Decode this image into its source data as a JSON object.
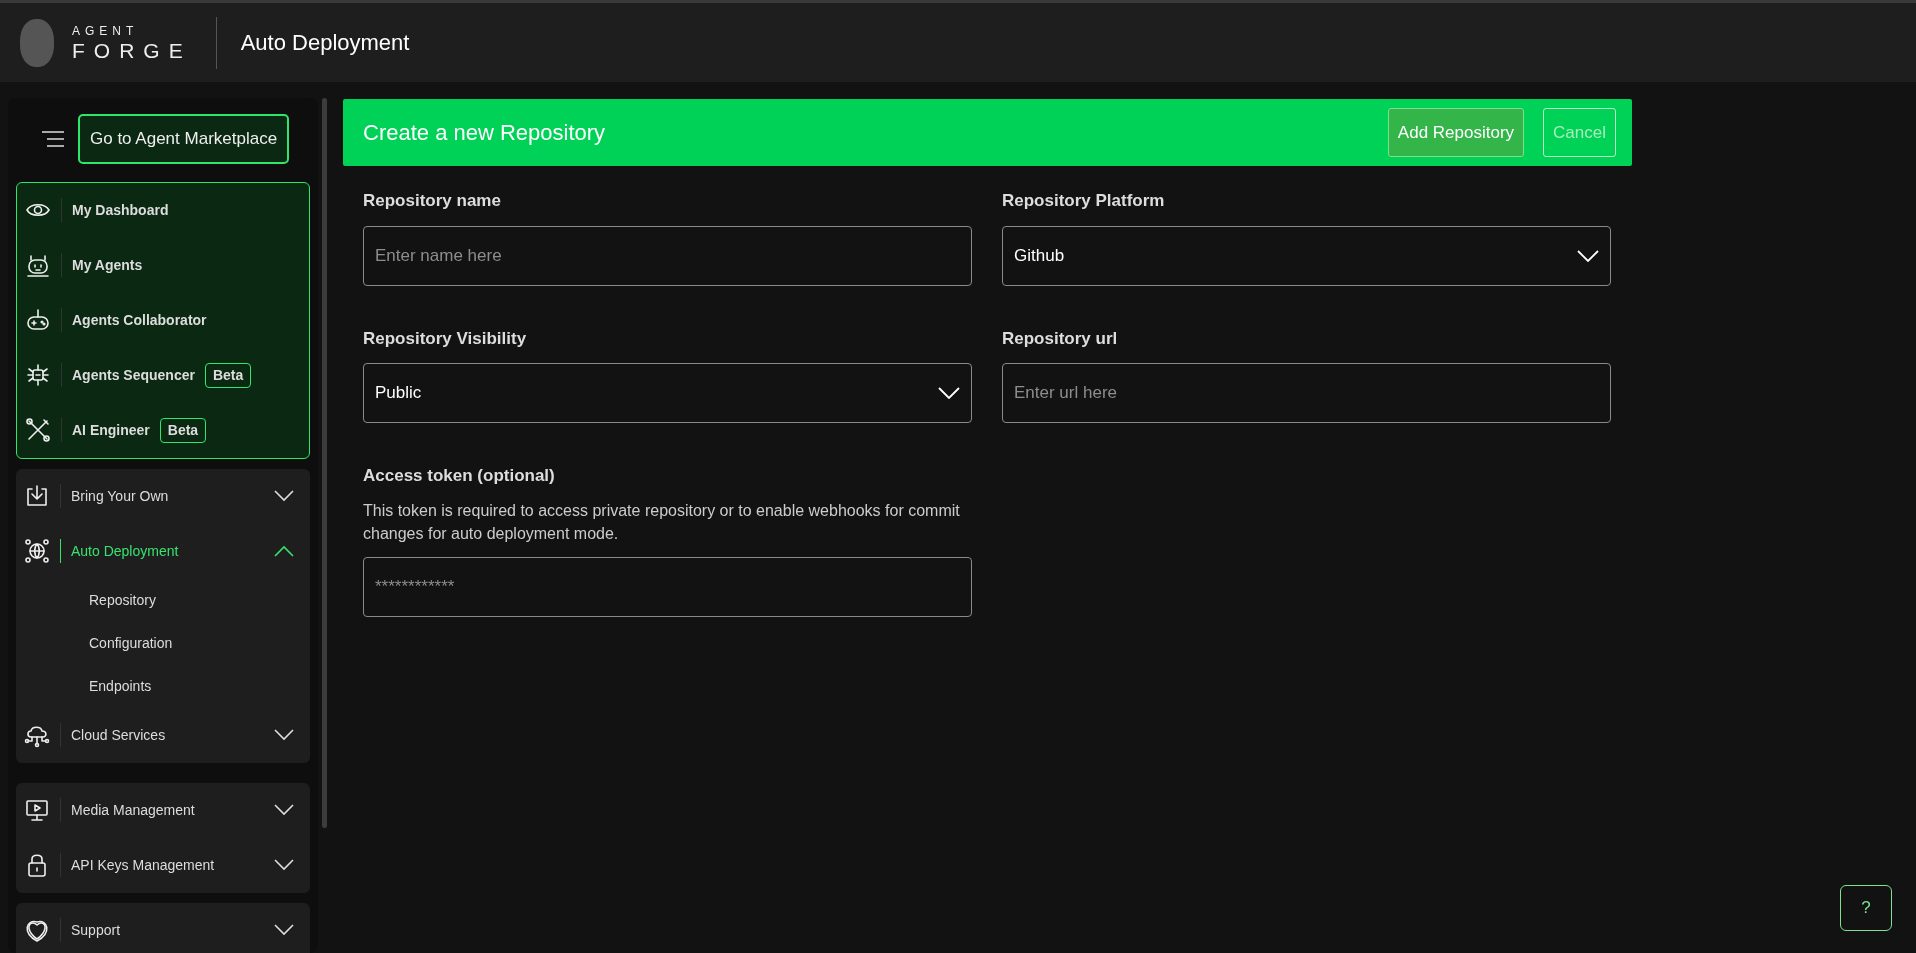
{
  "header": {
    "logo_top": "AGENT",
    "logo_bottom": "FORGE",
    "title": "Auto Deployment"
  },
  "sidebar": {
    "marketplace_button": "Go to Agent Marketplace",
    "groups": [
      {
        "highlighted": true,
        "items": [
          {
            "label": "My Dashboard",
            "selected": false
          },
          {
            "label": "My Agents",
            "selected": false
          },
          {
            "label": "Agents Collaborator",
            "selected": false
          },
          {
            "label": "Agents Sequencer",
            "badge": "Beta",
            "selected": false
          },
          {
            "label": "AI Engineer",
            "badge": "Beta",
            "selected": false
          }
        ]
      },
      {
        "highlighted": false,
        "items": [
          {
            "label": "Bring Your Own",
            "selected": false,
            "expanded": false
          },
          {
            "label": "Auto Deployment",
            "selected": true,
            "expanded": true,
            "children": [
              {
                "label": "Repository",
                "selected": false
              },
              {
                "label": "Configuration",
                "selected": false
              },
              {
                "label": "Endpoints",
                "selected": false
              }
            ]
          },
          {
            "label": "Cloud Services",
            "selected": false,
            "expanded": false
          }
        ]
      },
      {
        "highlighted": false,
        "items": [
          {
            "label": "Media Management",
            "selected": false,
            "expanded": false
          },
          {
            "label": "API Keys Management",
            "selected": false,
            "expanded": false
          }
        ]
      },
      {
        "highlighted": false,
        "items": [
          {
            "label": "Support",
            "selected": false,
            "expanded": false
          }
        ]
      }
    ]
  },
  "form": {
    "title": "Create a new Repository",
    "buttons": [
      {
        "label": "Add Repository",
        "disabled": false
      },
      {
        "label": "Cancel",
        "disabled": true
      }
    ],
    "fields": [
      {
        "kind": "text",
        "label": "Repository name",
        "placeholder": "Enter name here"
      },
      {
        "kind": "select",
        "label": "Repository Platform",
        "value": "Github"
      },
      {
        "kind": "select",
        "label": "Repository Visibility",
        "value": "Public"
      },
      {
        "kind": "text",
        "label": "Repository url",
        "placeholder": "Enter url here"
      },
      {
        "kind": "text",
        "label": "Access token (optional)",
        "description": "This token is required to access private repository or to enable webhooks for commit changes for auto deployment mode.",
        "placeholder": "************"
      }
    ]
  },
  "help_button": "?"
}
